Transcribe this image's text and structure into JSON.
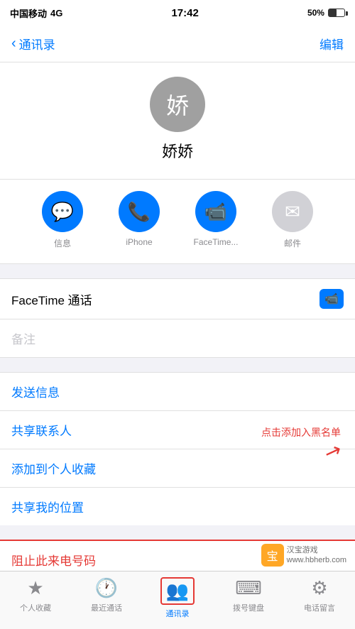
{
  "statusBar": {
    "carrier": "中国移动",
    "network": "4G",
    "time": "17:42",
    "battery": "50%"
  },
  "navBar": {
    "backLabel": "通讯录",
    "editLabel": "编辑"
  },
  "contact": {
    "avatarChar": "娇",
    "name": "娇娇"
  },
  "actions": [
    {
      "id": "message",
      "icon": "💬",
      "label": "信息",
      "type": "blue"
    },
    {
      "id": "phone",
      "icon": "📞",
      "label": "iPhone",
      "type": "blue"
    },
    {
      "id": "facetime",
      "icon": "📹",
      "label": "FaceTime...",
      "type": "blue"
    },
    {
      "id": "mail",
      "icon": "✉",
      "label": "邮件",
      "type": "gray"
    }
  ],
  "facetimeSection": {
    "label": "FaceTime 通话"
  },
  "notesSection": {
    "placeholder": "备注"
  },
  "listActions": [
    {
      "id": "send-message",
      "label": "发送信息"
    },
    {
      "id": "share-contact",
      "label": "共享联系人"
    },
    {
      "id": "add-favorites",
      "label": "添加到个人收藏"
    },
    {
      "id": "share-location",
      "label": "共享我的位置"
    }
  ],
  "blockSection": {
    "label": "阻止此来电号码"
  },
  "annotation": {
    "text": "点击添加入黑名单"
  },
  "tabBar": {
    "items": [
      {
        "id": "favorites",
        "icon": "★",
        "label": "个人收藏",
        "active": false
      },
      {
        "id": "recents",
        "icon": "🕐",
        "label": "最近通话",
        "active": false
      },
      {
        "id": "contacts",
        "icon": "👥",
        "label": "通讯录",
        "active": true
      },
      {
        "id": "keypad",
        "icon": "⌨",
        "label": "拨号键盘",
        "active": false
      },
      {
        "id": "voicemail",
        "icon": "⚙",
        "label": "电话留言",
        "active": false
      }
    ]
  },
  "watermark": {
    "siteName": "汉宝游戏",
    "url": "www.hbherb.com"
  }
}
